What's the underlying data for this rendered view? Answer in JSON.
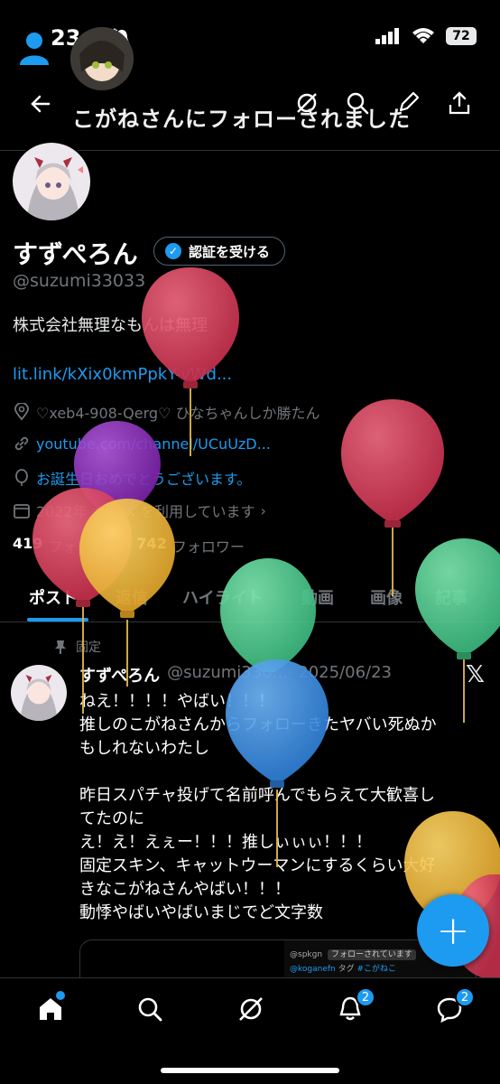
{
  "status": {
    "time": "23:06",
    "battery": "72"
  },
  "header": {
    "title": "こがねさんにフォローされました"
  },
  "profile": {
    "name": "すずぺろん",
    "verify_label": "認証を受ける",
    "handle": "@suzumi33033",
    "bio": "株式会社無理なもんは無理",
    "link": "lit.link/kXix0kmPpkY-vWd...",
    "location": "♡xeb4-908-Qerg♡ ひなちゃんしか勝たん",
    "website": "youtube.com/channel/UCuUzD...",
    "birthday": "お誕生日おめでとうございます。",
    "joined": "2022年  から X を利用しています",
    "following_count": "419",
    "following_label": "フォロー",
    "followers_count": "742",
    "followers_label": "フォロワー"
  },
  "tabs": [
    "ポスト",
    "返信",
    "ハイライト",
    "動画",
    "画像",
    "記事"
  ],
  "post": {
    "pinned_label": "固定",
    "author": "すずぺろん",
    "handle_date": "@suzumi330...· 2025/06/23",
    "text": "ねえ！！！！やばい！！！\n推しのこがねさんからフォローきたヤバい死ぬか\nもしれないわたし\n\n昨日スパチャ投げて名前呼んでもらえて大歓喜し\nてたのに\nえ！え！えぇー！！！推しぃぃぃ！！！\n固定スキン、キャットウーマンにするくらい大好\nきなこがねさんやばい！！！\n動悸やばいやばいまじでど文字数",
    "media_handle": "@spkgn",
    "media_tag": "フォローされています",
    "media_line2_user": "@koganefn",
    "media_line2_text": "タグ",
    "media_line2_hash": "#こがねこ"
  },
  "nav": {
    "notifications_badge": "2",
    "messages_badge": "2"
  },
  "colors": {
    "accent": "#1d9bf0",
    "background": "#000000"
  }
}
